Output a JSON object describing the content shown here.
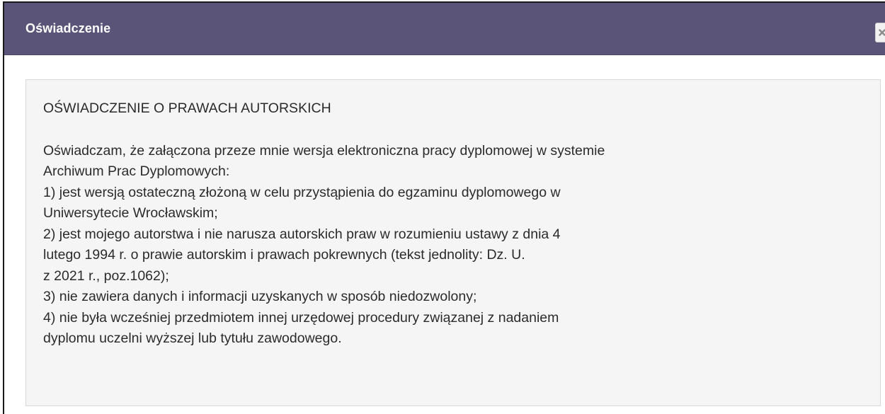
{
  "dialog": {
    "title": "Oświadczenie",
    "close_icon": "close-icon"
  },
  "statement": {
    "heading": "OŚWIADCZENIE O PRAWACH AUTORSKICH",
    "lines": [
      "Oświadczam, że załączona przeze mnie wersja elektroniczna pracy dyplomowej w systemie",
      "Archiwum Prac Dyplomowych:",
      "1) jest wersją ostateczną złożoną w celu przystąpienia do egzaminu dyplomowego w",
      "Uniwersytecie Wrocławskim;",
      "2) jest mojego autorstwa i nie narusza autorskich praw w rozumieniu ustawy z dnia 4",
      "lutego 1994 r. o prawie autorskim i prawach pokrewnych (tekst jednolity: Dz. U.",
      "z 2021 r., poz.1062);",
      "3) nie zawiera danych i informacji uzyskanych w sposób niedozwolony;",
      "4) nie była wcześniej przedmiotem innej urzędowej procedury związanej z nadaniem",
      "dyplomu uczelni wyższej lub tytułu zawodowego."
    ]
  },
  "colors": {
    "titlebar": "#5a5478",
    "content_bg": "#f5f5f5"
  }
}
